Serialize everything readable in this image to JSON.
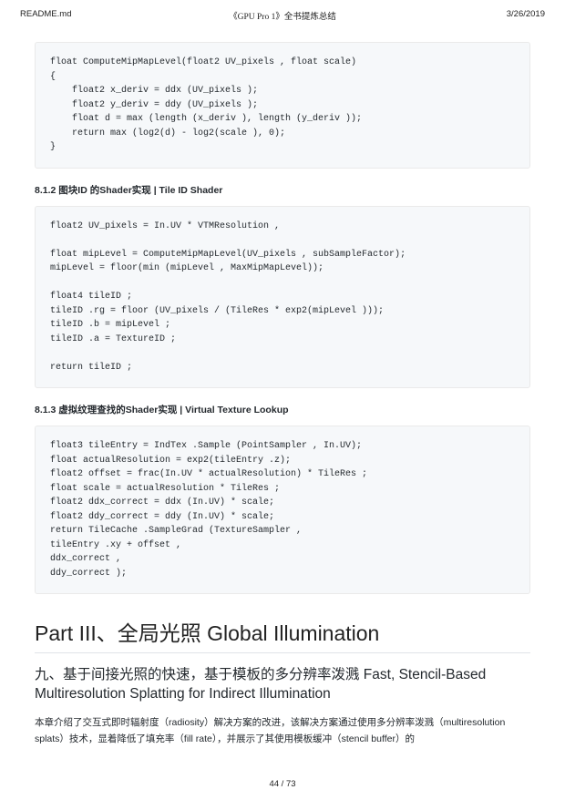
{
  "header": {
    "left": "README.md",
    "center": "《GPU Pro 1》全书提炼总结",
    "right": "3/26/2019"
  },
  "code1": "float ComputeMipMapLevel(float2 UV_pixels , float scale)\n{\n    float2 x_deriv = ddx (UV_pixels );\n    float2 y_deriv = ddy (UV_pixels );\n    float d = max (length (x_deriv ), length (y_deriv ));\n    return max (log2(d) - log2(scale ), 0);\n}",
  "sec812": "8.1.2 图块ID 的Shader实现 | Tile ID Shader",
  "code2": "float2 UV_pixels = In.UV * VTMResolution ,\n\nfloat mipLevel = ComputeMipMapLevel(UV_pixels , subSampleFactor);\nmipLevel = floor(min (mipLevel , MaxMipMapLevel));\n\nfloat4 tileID ;\ntileID .rg = floor (UV_pixels / (TileRes * exp2(mipLevel )));\ntileID .b = mipLevel ;\ntileID .a = TextureID ;\n\nreturn tileID ;",
  "sec813": "8.1.3 虚拟纹理查找的Shader实现 | Virtual Texture Lookup",
  "code3": "float3 tileEntry = IndTex .Sample (PointSampler , In.UV);\nfloat actualResolution = exp2(tileEntry .z);\nfloat2 offset = frac(In.UV * actualResolution) * TileRes ;\nfloat scale = actualResolution * TileRes ;\nfloat2 ddx_correct = ddx (In.UV) * scale;\nfloat2 ddy_correct = ddy (In.UV) * scale;\nreturn TileCache .SampleGrad (TextureSampler ,\ntileEntry .xy + offset ,\nddx_correct ,\nddy_correct );",
  "part_title": "Part III、全局光照 Global Illumination",
  "chapter_title": "九、基于间接光照的快速，基于模板的多分辨率泼溅 Fast, Stencil-Based Multiresolution Splatting for Indirect Illumination",
  "body_text": "本章介绍了交互式即时辐射度（radiosity）解决方案的改进，该解决方案通过使用多分辨率泼溅（multiresolution splats）技术，显着降低了填充率（fill rate），并展示了其使用模板缓冲（stencil buffer）的",
  "footer": "44 / 73"
}
